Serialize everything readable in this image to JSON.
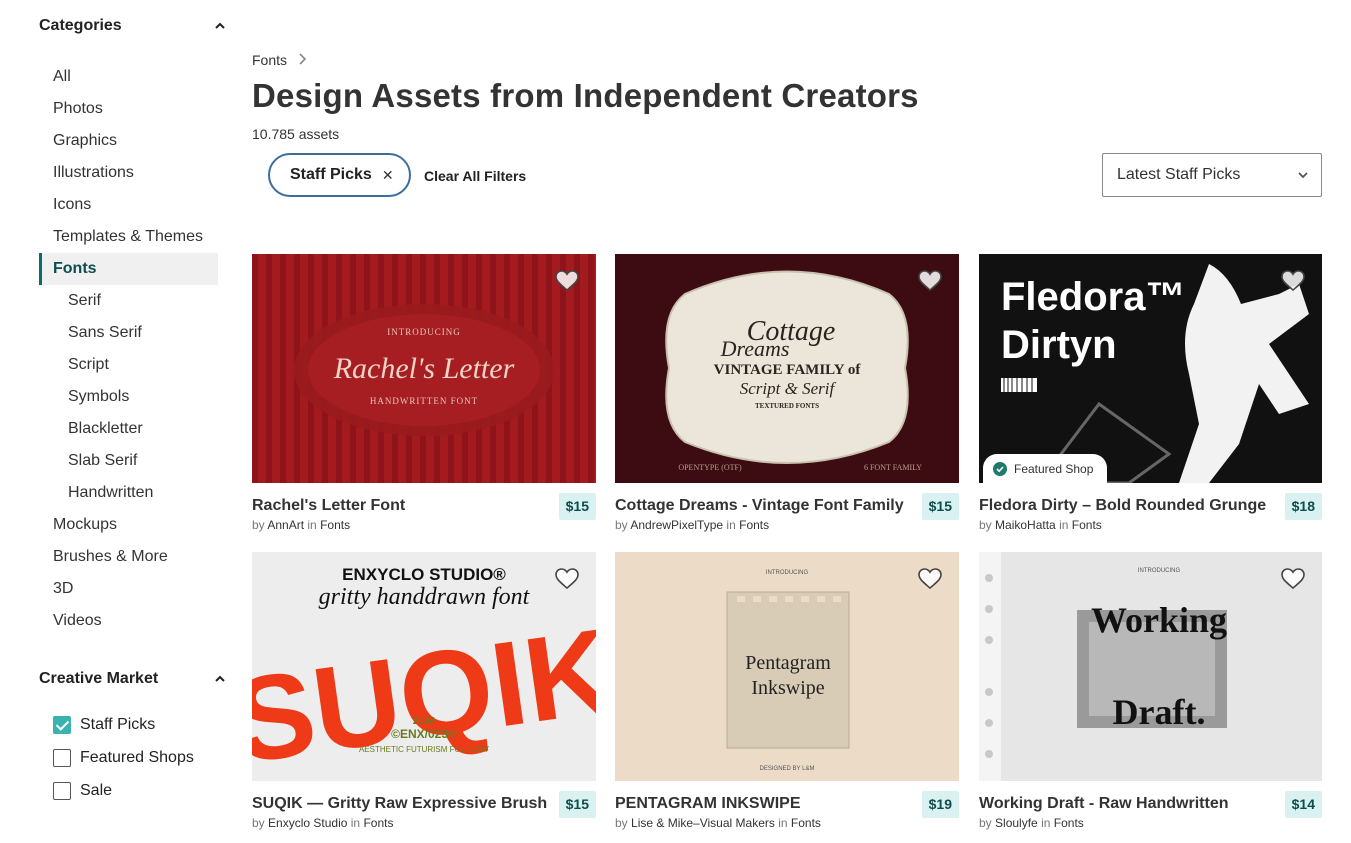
{
  "sidebar": {
    "categories_title": "Categories",
    "categories": [
      {
        "label": "All",
        "level": 0
      },
      {
        "label": "Photos",
        "level": 0
      },
      {
        "label": "Graphics",
        "level": 0
      },
      {
        "label": "Illustrations",
        "level": 0
      },
      {
        "label": "Icons",
        "level": 0
      },
      {
        "label": "Templates & Themes",
        "level": 0
      },
      {
        "label": "Fonts",
        "level": 0,
        "active": true
      },
      {
        "label": "Serif",
        "level": 1
      },
      {
        "label": "Sans Serif",
        "level": 1
      },
      {
        "label": "Script",
        "level": 1
      },
      {
        "label": "Symbols",
        "level": 1
      },
      {
        "label": "Blackletter",
        "level": 1
      },
      {
        "label": "Slab Serif",
        "level": 1
      },
      {
        "label": "Handwritten",
        "level": 1
      },
      {
        "label": "Mockups",
        "level": 0
      },
      {
        "label": "Brushes & More",
        "level": 0
      },
      {
        "label": "3D",
        "level": 0
      },
      {
        "label": "Videos",
        "level": 0
      }
    ],
    "market_title": "Creative Market",
    "filters": [
      {
        "label": "Staff Picks",
        "checked": true
      },
      {
        "label": "Featured Shops",
        "checked": false
      },
      {
        "label": "Sale",
        "checked": false
      }
    ]
  },
  "breadcrumb": {
    "label": "Fonts"
  },
  "page": {
    "title": "Design Assets from Independent Creators",
    "count": "10.785 assets"
  },
  "active_filter": {
    "label": "Staff Picks"
  },
  "clear_filters": "Clear All Filters",
  "sort": {
    "selected": "Latest Staff Picks"
  },
  "colors": {
    "accent": "#39b3b0",
    "price_bg": "#d9f2f1",
    "pill_border": "#3c6e9c"
  },
  "products": [
    {
      "name": "Rachel's Letter Font",
      "price": "$15",
      "author": "AnnArt",
      "category": "Fonts",
      "thumb": {
        "line1": "INTRODUCING",
        "line2": "Rachel's Letter",
        "line3": "HANDWRITTEN FONT"
      }
    },
    {
      "name": "Cottage Dreams - Vintage Font Family",
      "price": "$15",
      "author": "AndrewPixelType",
      "category": "Fonts",
      "thumb": {
        "line1": "Cottage",
        "line2": "Dreams",
        "line3": "VINTAGE FAMILY of",
        "line4": "Script & Serif",
        "line5": "TEXTURED FONTS",
        "line6": "OPENTYPE (OTF)",
        "line7": "6 FONT FAMILY"
      }
    },
    {
      "name": "Fledora Dirty – Bold Rounded Grunge",
      "price": "$18",
      "author": "MaikoHatta",
      "category": "Fonts",
      "featured": "Featured Shop",
      "thumb": {
        "line1": "Fledora™",
        "line2": "Dirtyn"
      }
    },
    {
      "name": "SUQIK — Gritty Raw Expressive Brush",
      "price": "$15",
      "author": "Enxyclo Studio",
      "category": "Fonts",
      "thumb": {
        "line1": "ENXYCLO STUDIO®",
        "line2": "gritty handdrawn font",
        "line3": "SUQIK",
        "line4": "2134",
        "line5": "©ENX/023®",
        "line6": "AESTHETIC FUTURISM FOUNDRY"
      }
    },
    {
      "name": "PENTAGRAM INKSWIPE",
      "price": "$19",
      "author": "Lise & Mike–Visual Makers",
      "category": "Fonts",
      "thumb": {
        "line1": "INTRODUCING",
        "line2": "Pentagram",
        "line3": "Inkswipe",
        "line4": "DESIGNED BY L&M"
      }
    },
    {
      "name": "Working Draft - Raw Handwritten",
      "price": "$14",
      "author": "Sloulyfe",
      "category": "Fonts",
      "thumb": {
        "line1": "INTRODUCING",
        "line2": "Working",
        "line3": "Draft."
      }
    }
  ],
  "labels": {
    "by": "by",
    "in": "in"
  }
}
